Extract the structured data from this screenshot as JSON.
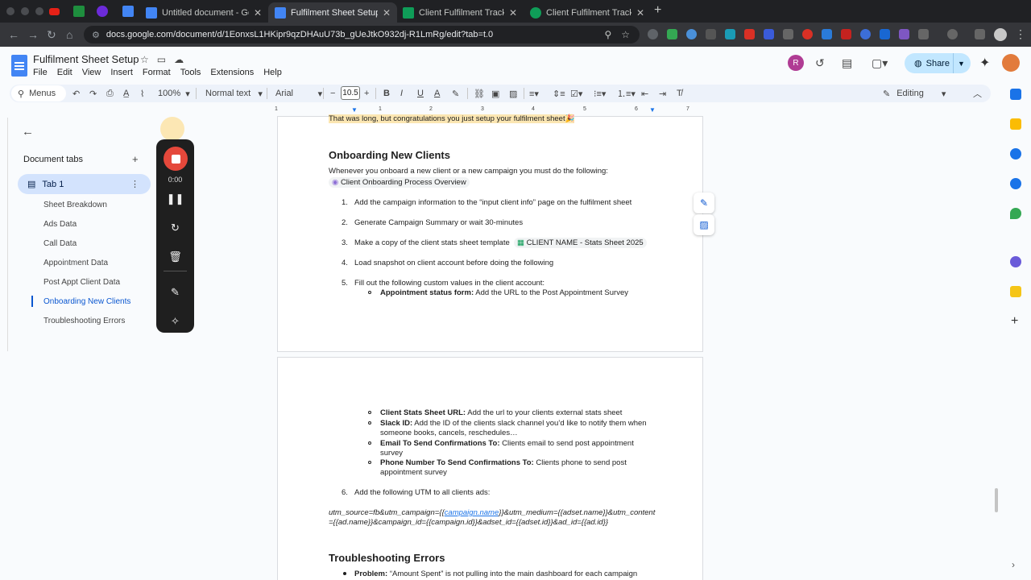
{
  "browser": {
    "tabs": [
      {
        "title": "Untitled document - Google D",
        "icon": "docs-icon",
        "active": false
      },
      {
        "title": "Fulfilment Sheet Setup - Goo",
        "icon": "docs-icon",
        "active": true
      },
      {
        "title": "Client Fulfilment Tracker [TEM",
        "icon": "sheets-icon",
        "active": false
      },
      {
        "title": "Client Fulfilment Tracker [TEM",
        "icon": "sheets-icon",
        "active": false
      }
    ],
    "url": "docs.google.com/document/d/1EonxsL1HKipr9qzDHAuU73b_gUeJtkO932dj-R1LmRg/edit?tab=t.0"
  },
  "doc": {
    "title": "Fulfilment Sheet Setup",
    "menu": [
      "File",
      "Edit",
      "View",
      "Insert",
      "Format",
      "Tools",
      "Extensions",
      "Help"
    ],
    "share_label": "Share"
  },
  "toolbar": {
    "menus_label": "Menus",
    "zoom": "100%",
    "style": "Normal text",
    "font": "Arial",
    "font_size": "10.5",
    "mode": "Editing"
  },
  "ruler": [
    "1",
    "1",
    "2",
    "3",
    "4",
    "5",
    "6",
    "7"
  ],
  "tabs_panel": {
    "heading": "Document tabs",
    "tab_name": "Tab 1",
    "outline": [
      "Sheet Breakdown",
      "Ads Data",
      "Call Data",
      "Appointment Data",
      "Post Appt Client Data",
      "Onboarding New Clients",
      "Troubleshooting Errors"
    ],
    "active_outline": "Onboarding New Clients"
  },
  "recorder": {
    "time": "0:00"
  },
  "content": {
    "top_line": "That was long, but congratulations you just setup your fulfilment sheet",
    "h_onboarding": "Onboarding New Clients",
    "intro": "Whenever you onboard a new client or a new campaign you must do the following:",
    "chip_overview": "Client Onboarding Process Overview",
    "step1": "Add the campaign information to the “input client info” page on the fulfilment sheet",
    "step2": "Generate Campaign Summary or wait 30-minutes",
    "step3": "Make a copy of the client stats sheet template",
    "chip_stats": "CLIENT NAME - Stats Sheet 2025",
    "step4": "Load snapshot on client account before doing the following",
    "step5": "Fill out the following custom values in the client account:",
    "cv1_label": "Appointment status form:",
    "cv1_text": "Add the URL to the Post Appointment Survey",
    "cv2_label": "Client Stats Sheet URL:",
    "cv2_text": "Add the url to your clients external stats sheet",
    "cv3_label": "Slack ID:",
    "cv3_text": "Add the ID of the clients slack channel you’d like to notify them when",
    "cv3_text2": "someone books, cancels, reschedules…",
    "cv4_label": "Email To Send Confirmations To:",
    "cv4_text": "Clients email to send post appointment",
    "cv4_text2": "survey",
    "cv5_label": "Phone Number To Send Confirmations To:",
    "cv5_text": "Clients phone to send post",
    "cv5_text2": "appointment survey",
    "step6": "Add the following UTM to all clients ads:",
    "utm_a": "utm_source=fb&utm_campaign={{",
    "utm_link": "campaign.name",
    "utm_b": "}}&utm_medium={{adset.name}}&utm_content",
    "utm_line2": "={{ad.name}}&campaign_id={{campaign.id}}&adset_id={{adset.id}}&ad_id={{ad.id}}",
    "h_trouble": "Troubleshooting Errors",
    "problem_label": "Problem:",
    "problem_text": "“Amount Spent” is not pulling into the main dashboard for each campaign",
    "nums": [
      "1.",
      "2.",
      "3.",
      "4.",
      "5.",
      "6."
    ]
  }
}
